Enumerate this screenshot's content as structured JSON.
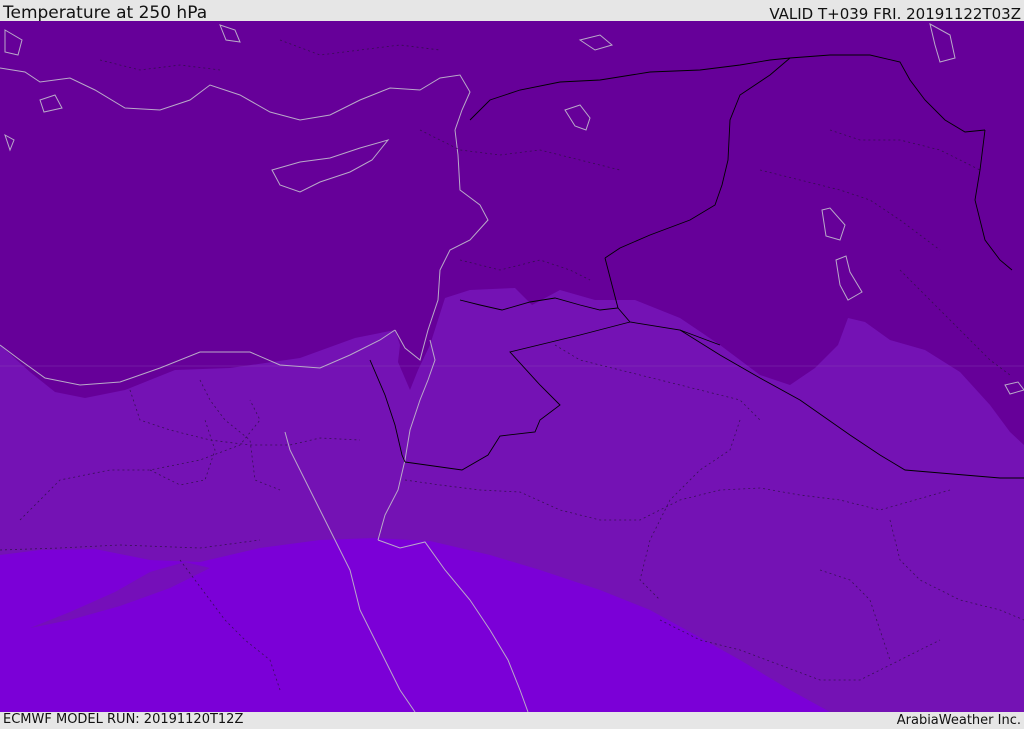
{
  "header": {
    "title": "Temperature at 250 hPa",
    "valid": "VALID T+039 FRI. 20191122T03Z"
  },
  "footer": {
    "model_run": "ECMWF MODEL RUN: 20191120T12Z",
    "brand": "ArabiaWeather Inc."
  },
  "colors": {
    "band_cold": "#660099",
    "band_mid": "#7412b4",
    "band_warm": "#7b00d7",
    "coast": "#b9a9c9",
    "border": "#000000",
    "frame": "#e6e6e6"
  }
}
